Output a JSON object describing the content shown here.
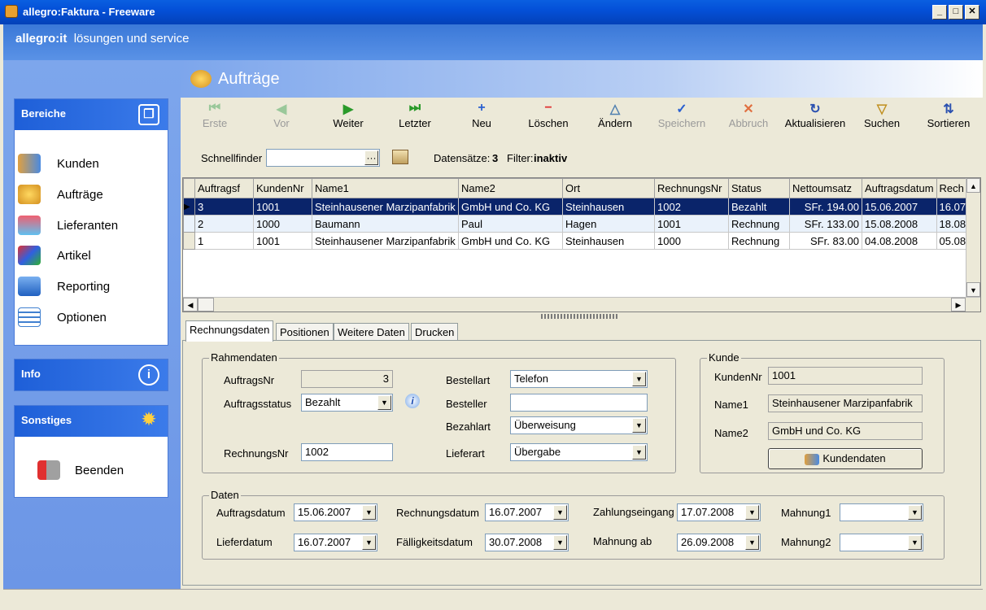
{
  "window": {
    "title": "allegro:Faktura - Freeware"
  },
  "header": {
    "brand": "allegro:it",
    "tagline": "lösungen und service"
  },
  "sidebar": {
    "bereiche": {
      "title": "Bereiche",
      "items": [
        {
          "label": "Kunden"
        },
        {
          "label": "Aufträge"
        },
        {
          "label": "Lieferanten"
        },
        {
          "label": "Artikel"
        },
        {
          "label": "Reporting"
        },
        {
          "label": "Optionen"
        }
      ]
    },
    "info": {
      "title": "Info"
    },
    "sonstiges": {
      "title": "Sonstiges",
      "items": [
        {
          "label": "Beenden"
        }
      ]
    }
  },
  "page": {
    "title": "Aufträge"
  },
  "toolbar": {
    "buttons": [
      {
        "label": "Erste",
        "glyph": "⏮"
      },
      {
        "label": "Vor",
        "glyph": "◀"
      },
      {
        "label": "Weiter",
        "glyph": "▶"
      },
      {
        "label": "Letzter",
        "glyph": "⏭"
      },
      {
        "label": "Neu",
        "glyph": "+"
      },
      {
        "label": "Löschen",
        "glyph": "−"
      },
      {
        "label": "Ändern",
        "glyph": "△"
      },
      {
        "label": "Speichern",
        "glyph": "✓"
      },
      {
        "label": "Abbruch",
        "glyph": "✕"
      },
      {
        "label": "Aktualisieren",
        "glyph": "↻"
      },
      {
        "label": "Suchen",
        "glyph": "▽"
      },
      {
        "label": "Sortieren",
        "glyph": "⇅"
      }
    ]
  },
  "filterbar": {
    "schnellfinder_label": "Schnellfinder",
    "schnellfinder_value": "",
    "datensaetze_label": "Datensätze:",
    "datensaetze_value": "3",
    "filter_label": "Filter:",
    "filter_value": "inaktiv"
  },
  "grid": {
    "columns": [
      "Auftragsf",
      "KundenNr",
      "Name1",
      "Name2",
      "Ort",
      "RechnungsNr",
      "Status",
      "Nettoumsatz",
      "Auftragsdatum",
      "Rech"
    ],
    "rows": [
      [
        "3",
        "1001",
        "Steinhausener Marzipanfabrik",
        "GmbH und Co. KG",
        "Steinhausen",
        "1002",
        "Bezahlt",
        "SFr. 194.00",
        "15.06.2007",
        "16.07."
      ],
      [
        "2",
        "1000",
        "Baumann",
        "Paul",
        "Hagen",
        "1001",
        "Rechnung",
        "SFr. 133.00",
        "15.08.2008",
        "18.08."
      ],
      [
        "1",
        "1001",
        "Steinhausener Marzipanfabrik",
        "GmbH und Co. KG",
        "Steinhausen",
        "1000",
        "Rechnung",
        "SFr. 83.00",
        "04.08.2008",
        "05.08."
      ]
    ]
  },
  "tabs": [
    "Rechnungsdaten",
    "Positionen",
    "Weitere Daten",
    "Drucken"
  ],
  "rahmendaten": {
    "title": "Rahmendaten",
    "auftragsnr_label": "AuftragsNr",
    "auftragsnr": "3",
    "auftragsstatus_label": "Auftragsstatus",
    "auftragsstatus": "Bezahlt",
    "rechnungsnr_label": "RechnungsNr",
    "rechnungsnr": "1002",
    "bestellart_label": "Bestellart",
    "bestellart": "Telefon",
    "besteller_label": "Besteller",
    "besteller": "",
    "bezahlart_label": "Bezahlart",
    "bezahlart": "Überweisung",
    "lieferart_label": "Lieferart",
    "lieferart": "Übergabe"
  },
  "kunde": {
    "title": "Kunde",
    "kundennr_label": "KundenNr",
    "kundennr": "1001",
    "name1_label": "Name1",
    "name1": "Steinhausener Marzipanfabrik",
    "name2_label": "Name2",
    "name2": "GmbH und Co. KG",
    "button": "Kundendaten"
  },
  "daten": {
    "title": "Daten",
    "auftragsdatum_label": "Auftragsdatum",
    "auftragsdatum": "15.06.2007",
    "lieferdatum_label": "Lieferdatum",
    "lieferdatum": "16.07.2007",
    "rechnungsdatum_label": "Rechnungsdatum",
    "rechnungsdatum": "16.07.2007",
    "faelligkeitsdatum_label": "Fälligkeitsdatum",
    "faelligkeitsdatum": "30.07.2008",
    "zahlungseingang_label": "Zahlungseingang",
    "zahlungseingang": "17.07.2008",
    "mahnung_ab_label": "Mahnung ab",
    "mahnung_ab": "26.09.2008",
    "mahnung1_label": "Mahnung1",
    "mahnung1": "",
    "mahnung2_label": "Mahnung2",
    "mahnung2": ""
  }
}
